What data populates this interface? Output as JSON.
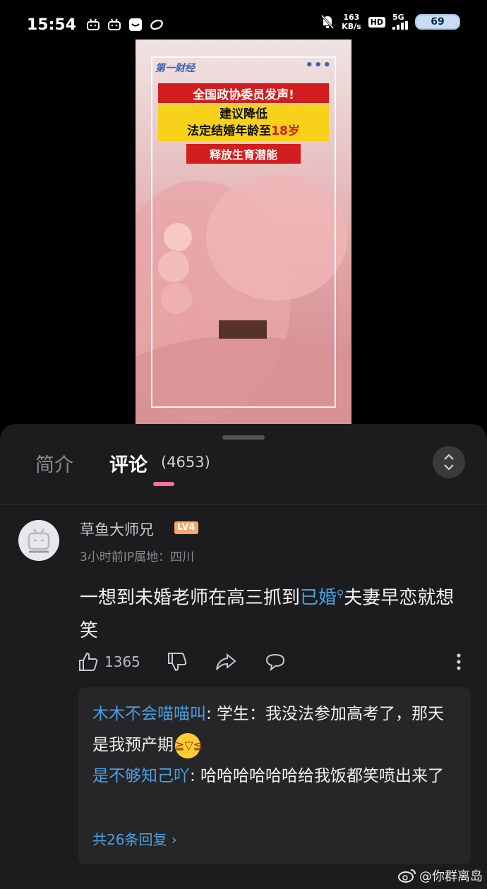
{
  "status_bar": {
    "time": "15:54",
    "net_speed_value": "163",
    "net_speed_unit": "KB/s",
    "hd": "HD",
    "signal": "5G",
    "battery": "69"
  },
  "video": {
    "brand": "第一财经",
    "more": "•••",
    "headline_1": "全国政协委员发声!",
    "headline_2_line1": "建议降低",
    "headline_2_line2_prefix": "法定结婚年龄至",
    "headline_2_line2_highlight": "18岁",
    "headline_3": "释放生育潜能"
  },
  "panel": {
    "tabs": [
      {
        "label": "简介"
      },
      {
        "label": "评论"
      }
    ],
    "comment_count": "(4653)"
  },
  "comment": {
    "username": "草鱼大师兄",
    "level": "LV4",
    "meta": "3小时前IP属地：四川",
    "text_before": "一想到未婚老师在高三抓到",
    "hashtag": "已婚",
    "text_after": "夫妻早恋就想笑",
    "likes": "1365"
  },
  "replies": [
    {
      "user": "木木不会喵喵叫",
      "text": ": 学生：我没法参加高考了，那天是我预产期"
    },
    {
      "user": "是不够知己吖",
      "text": ": 哈哈哈哈哈哈给我饭都笑喷出来了"
    }
  ],
  "more_replies": "共26条回复 ›",
  "watermark": "@你群离岛"
}
